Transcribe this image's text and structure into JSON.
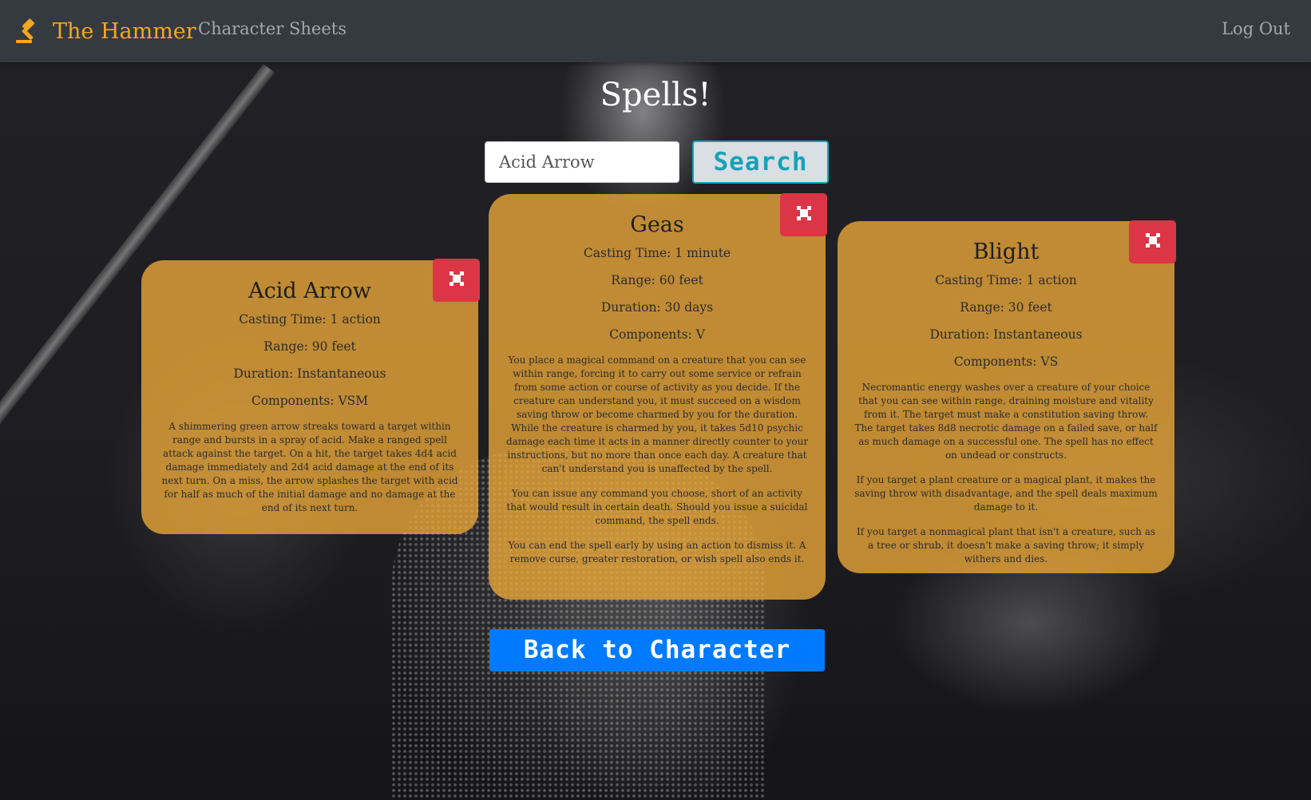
{
  "navbar": {
    "brand_label": "The Hammer",
    "brand_icon": "gavel-icon",
    "links": [
      {
        "label": "Character Sheets"
      }
    ],
    "logout_label": "Log Out",
    "brand_color": "#f6a623",
    "bg_color": "#343a40"
  },
  "page": {
    "title": "Spells!"
  },
  "search": {
    "value": "Acid Arrow",
    "button_label": "Search",
    "button_color": "#17a2b8"
  },
  "cards": [
    {
      "name": "Acid Arrow",
      "casting_time": "Casting Time: 1 action",
      "range": "Range: 90 feet",
      "duration": "Duration: Instantaneous",
      "components": "Components: VSM",
      "description": [
        "A shimmering green arrow streaks toward a target within range and bursts in a spray of acid. Make a ranged spell attack against the target. On a hit, the target takes 4d4 acid damage immediately and 2d4 acid damage at the end of its next turn. On a miss, the arrow splashes the target with acid for half as much of the initial damage and no damage at the end of its next turn."
      ]
    },
    {
      "name": "Geas",
      "casting_time": "Casting Time: 1 minute",
      "range": "Range: 60 feet",
      "duration": "Duration: 30 days",
      "components": "Components: V",
      "description": [
        "You place a magical command on a creature that you can see within range, forcing it to carry out some service or refrain from some action or course of activity as you decide. If the creature can understand you, it must succeed on a wisdom saving throw or become charmed by you for the duration. While the creature is charmed by you, it takes 5d10 psychic damage each time it acts in a manner directly counter to your instructions, but no more than once each day. A creature that can't understand you is unaffected by the spell.",
        "You can issue any command you choose, short of an activity that would result in certain death. Should you issue a suicidal command, the spell ends.",
        "You can end the spell early by using an action to dismiss it. A remove curse, greater restoration, or wish spell also ends it."
      ]
    },
    {
      "name": "Blight",
      "casting_time": "Casting Time: 1 action",
      "range": "Range: 30 feet",
      "duration": "Duration: Instantaneous",
      "components": "Components: VS",
      "description": [
        "Necromantic energy washes over a creature of your choice that you can see within range, draining moisture and vitality from it. The target must make a constitution saving throw. The target takes 8d8 necrotic damage on a failed save, or half as much damage on a successful one. The spell has no effect on undead or constructs.",
        "If you target a plant creature or a magical plant, it makes the saving throw with disadvantage, and the spell deals maximum damage to it.",
        "If you target a nonmagical plant that isn't a creature, such as a tree or shrub, it doesn't make a saving throw; it simply withers and dies."
      ]
    }
  ],
  "close_icon": "close-icon",
  "close_color": "#dc3545",
  "card_color": "#e8a638",
  "back_button": {
    "label": "Back to Character",
    "color": "#007bff"
  }
}
